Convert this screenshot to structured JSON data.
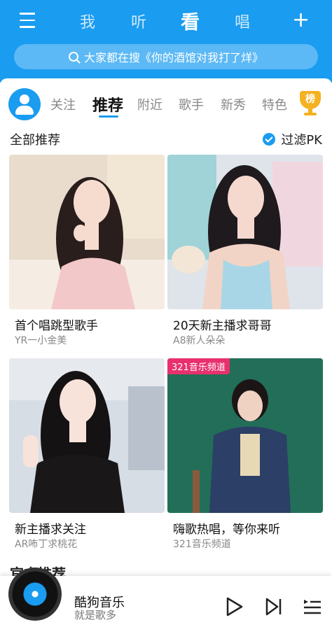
{
  "topnav": {
    "tabs": [
      {
        "label": "我"
      },
      {
        "label": "听"
      },
      {
        "label": "看"
      },
      {
        "label": "唱"
      }
    ],
    "plus": "+"
  },
  "search": {
    "text": "大家都在搜《你的酒馆对我打了烊》"
  },
  "categories": [
    {
      "label": "关注"
    },
    {
      "label": "推荐"
    },
    {
      "label": "附近"
    },
    {
      "label": "歌手"
    },
    {
      "label": "新秀"
    },
    {
      "label": "特色"
    }
  ],
  "rank_badge": "榜",
  "section": {
    "title": "全部推荐",
    "filter_label": "过滤PK"
  },
  "cards": [
    {
      "title": "首个唱跳型歌手",
      "subtitle": "YR一小金美"
    },
    {
      "title": "20天新主播求哥哥",
      "subtitle": "A8新人朵朵"
    },
    {
      "title": "新主播求关注",
      "subtitle": "AR咘丁求桃花"
    },
    {
      "title": "嗨歌热唱，等你来听",
      "subtitle": "321音乐频道",
      "badge": "321音乐频道"
    }
  ],
  "official_title": "官方推荐",
  "player": {
    "song": "酷狗音乐",
    "artist": "就是歌多"
  },
  "colors": {
    "brand_blue": "#1a9cf0",
    "badge_pink": "#e8306e",
    "gold": "#f4b120"
  }
}
